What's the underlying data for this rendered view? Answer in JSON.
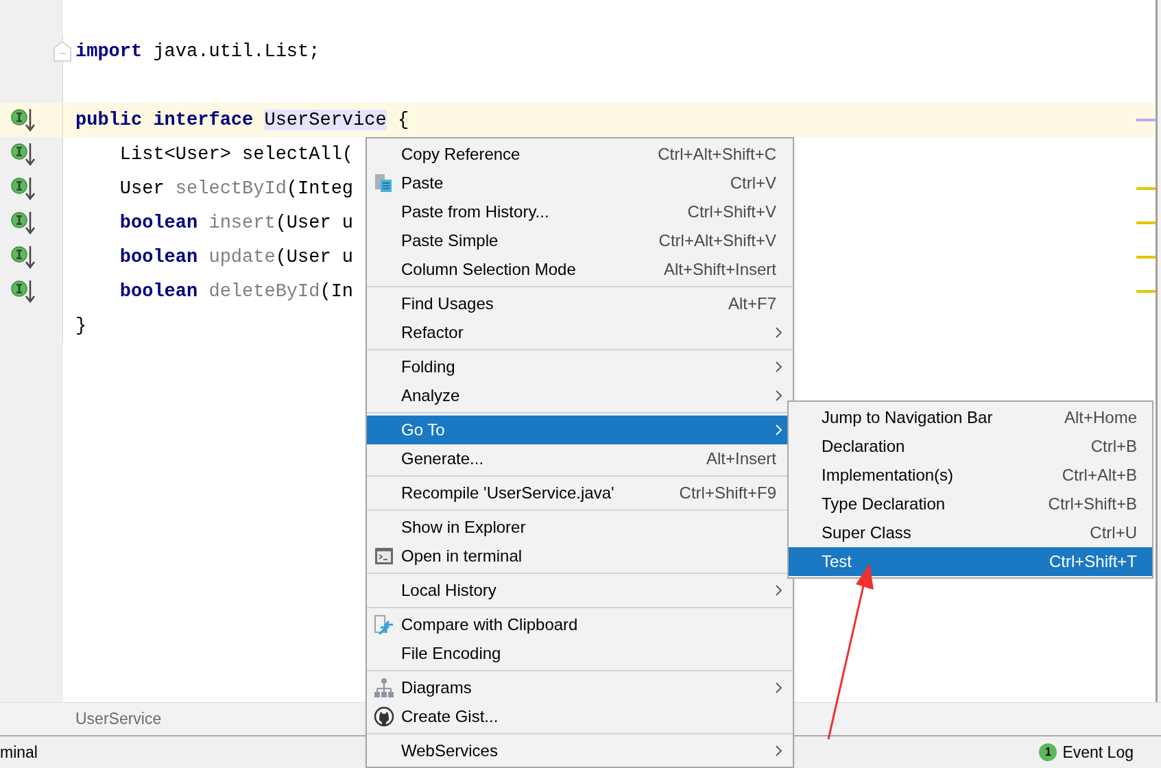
{
  "code": {
    "lines": [
      {
        "fold": true,
        "gutter_icon": false,
        "current": false,
        "tokens": [
          {
            "kind": "keyword",
            "text": "import"
          },
          {
            "kind": "plain",
            "text": " java.util.List;"
          }
        ]
      },
      {
        "fold": false,
        "gutter_icon": false,
        "current": false
      },
      {
        "fold": false,
        "gutter_icon": true,
        "current": true,
        "color": "#b8aaf7",
        "tokens": [
          {
            "kind": "keyword",
            "text": "public interface "
          },
          {
            "kind": "highlight",
            "text": "UserService"
          },
          {
            "kind": "plain",
            "text": " {"
          }
        ]
      },
      {
        "fold": false,
        "gutter_icon": true,
        "current": false,
        "tokens": [
          {
            "kind": "plain",
            "text": "    List<User> selectAll("
          }
        ]
      },
      {
        "fold": false,
        "gutter_icon": true,
        "current": false,
        "color": "#e6c400",
        "tokens": [
          {
            "kind": "plain",
            "text": "    User "
          },
          {
            "kind": "unused",
            "text": "selectById"
          },
          {
            "kind": "plain",
            "text": "(Integ"
          }
        ]
      },
      {
        "fold": false,
        "gutter_icon": true,
        "current": false,
        "color": "#e6c400",
        "tokens": [
          {
            "kind": "keyword",
            "text": "    boolean "
          },
          {
            "kind": "unused",
            "text": "insert"
          },
          {
            "kind": "plain",
            "text": "(User u"
          }
        ]
      },
      {
        "fold": false,
        "gutter_icon": true,
        "current": false,
        "color": "#e6c400",
        "tokens": [
          {
            "kind": "keyword",
            "text": "    boolean "
          },
          {
            "kind": "unused",
            "text": "update"
          },
          {
            "kind": "plain",
            "text": "(User u"
          }
        ]
      },
      {
        "fold": false,
        "gutter_icon": true,
        "current": false,
        "color": "#e6c400",
        "tokens": [
          {
            "kind": "keyword",
            "text": "    boolean "
          },
          {
            "kind": "unused",
            "text": "deleteById"
          },
          {
            "kind": "plain",
            "text": "(In"
          }
        ]
      },
      {
        "fold": false,
        "gutter_icon": false,
        "current": false,
        "tokens": [
          {
            "kind": "plain",
            "text": "}"
          }
        ]
      }
    ]
  },
  "context_menu": {
    "groups": [
      [
        {
          "kind": "plain",
          "label": "Copy Reference",
          "shortcut": "Ctrl+Alt+Shift+C",
          "submenu": false,
          "selected": false
        },
        {
          "kind": "paste",
          "label": "Paste",
          "shortcut": "Ctrl+V",
          "submenu": false,
          "selected": false
        },
        {
          "kind": "plain",
          "label": "Paste from History...",
          "shortcut": "Ctrl+Shift+V",
          "submenu": false,
          "selected": false
        },
        {
          "kind": "plain",
          "label": "Paste Simple",
          "shortcut": "Ctrl+Alt+Shift+V",
          "submenu": false,
          "selected": false
        },
        {
          "kind": "plain",
          "label": "Column Selection Mode",
          "shortcut": "Alt+Shift+Insert",
          "submenu": false,
          "selected": false
        }
      ],
      [
        {
          "kind": "plain",
          "label": "Find Usages",
          "shortcut": "Alt+F7",
          "submenu": false,
          "selected": false
        },
        {
          "kind": "plain",
          "label": "Refactor",
          "submenu": true,
          "selected": false
        }
      ],
      [
        {
          "kind": "plain",
          "label": "Folding",
          "submenu": true,
          "selected": false
        },
        {
          "kind": "plain",
          "label": "Analyze",
          "submenu": true,
          "selected": false
        }
      ],
      [
        {
          "kind": "plain",
          "label": "Go To",
          "submenu": true,
          "selected": true
        },
        {
          "kind": "plain",
          "label": "Generate...",
          "shortcut": "Alt+Insert",
          "submenu": false,
          "selected": false
        }
      ],
      [
        {
          "kind": "plain",
          "label": "Recompile 'UserService.java'",
          "shortcut": "Ctrl+Shift+F9",
          "submenu": false,
          "selected": false
        }
      ],
      [
        {
          "kind": "plain",
          "label": "Show in Explorer",
          "submenu": false,
          "selected": false
        },
        {
          "kind": "terminal",
          "label": "Open in terminal",
          "submenu": false,
          "selected": false
        }
      ],
      [
        {
          "kind": "plain",
          "label": "Local History",
          "submenu": true,
          "selected": false
        }
      ],
      [
        {
          "kind": "compare",
          "label": "Compare with Clipboard",
          "submenu": false,
          "selected": false
        },
        {
          "kind": "plain",
          "label": "File Encoding",
          "submenu": false,
          "selected": false
        }
      ],
      [
        {
          "kind": "diagram",
          "label": "Diagrams",
          "submenu": true,
          "selected": false
        },
        {
          "kind": "gist",
          "label": "Create Gist...",
          "submenu": false,
          "selected": false
        }
      ],
      [
        {
          "kind": "plain",
          "label": "WebServices",
          "submenu": true,
          "selected": false
        }
      ]
    ]
  },
  "submenu": {
    "items": [
      {
        "label": "Jump to Navigation Bar",
        "shortcut": "Alt+Home",
        "selected": false
      },
      {
        "label": "Declaration",
        "shortcut": "Ctrl+B",
        "selected": false
      },
      {
        "label": "Implementation(s)",
        "shortcut": "Ctrl+Alt+B",
        "selected": false
      },
      {
        "label": "Type Declaration",
        "shortcut": "Ctrl+Shift+B",
        "selected": false
      },
      {
        "label": "Super Class",
        "shortcut": "Ctrl+U",
        "selected": false
      },
      {
        "label": "Test",
        "shortcut": "Ctrl+Shift+T",
        "selected": true
      }
    ]
  },
  "breadcrumb": {
    "label": "UserService"
  },
  "status_bar": {
    "left": "minal",
    "event_badge": "1",
    "event_log": "Event Log"
  }
}
